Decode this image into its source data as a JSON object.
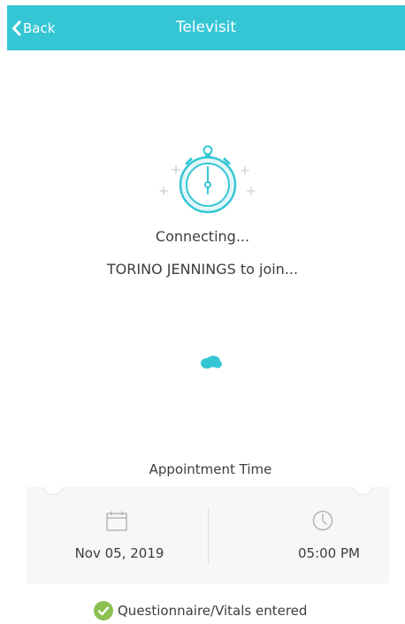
{
  "header": {
    "back_label": "Back",
    "title": "Televisit"
  },
  "status": {
    "connecting": "Connecting...",
    "waiting": "TORINO JENNINGS to join..."
  },
  "appointment": {
    "label": "Appointment Time",
    "date": "Nov 05, 2019",
    "time": "05:00 PM"
  },
  "footer": {
    "questionnaire_label": "Questionnaire/Vitals entered"
  },
  "icons": {
    "back": "chevron-left-icon",
    "stopwatch": "stopwatch-icon",
    "loader": "loading-indicator",
    "calendar": "calendar-icon",
    "clock": "clock-icon",
    "check": "check-circle-icon"
  },
  "colors": {
    "accent": "#35c6d5",
    "success": "#8cc152",
    "muted_icon": "#b5b5b5"
  }
}
